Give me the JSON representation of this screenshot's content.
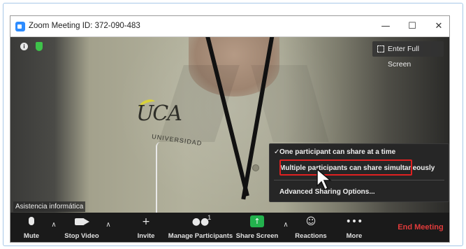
{
  "window": {
    "title": "Zoom Meeting ID: 372-090-483",
    "minimize": "—",
    "maximize": "☐",
    "close": "✕"
  },
  "video": {
    "fullscreen_label": "Enter Full Screen",
    "participant_name": "Asistencia informática",
    "logo_text": "UCA",
    "logo_subtext": "UNIVERSIDAD"
  },
  "toolbar": {
    "mute_label": "Mute",
    "stop_video_label": "Stop Video",
    "invite_label": "Invite",
    "invite_icon": "+",
    "manage_participants_label": "Manage Participants",
    "participants_count": "1",
    "participants_icon": "●●",
    "share_screen_label": "Share Screen",
    "share_icon": "↑",
    "reactions_label": "Reactions",
    "reactions_icon": "☺",
    "more_label": "More",
    "more_icon": "•••",
    "end_meeting_label": "End Meeting",
    "caret_up": "∧"
  },
  "share_menu": {
    "check": "✓",
    "items": [
      "One participant can share at a time",
      "Multiple participants can share simultaneously",
      "Advanced Sharing Options..."
    ]
  },
  "colors": {
    "accent_green": "#23b14d",
    "end_meeting_red": "#e23b3b",
    "highlight_red": "#e02020",
    "zoom_blue": "#2d8cff"
  }
}
